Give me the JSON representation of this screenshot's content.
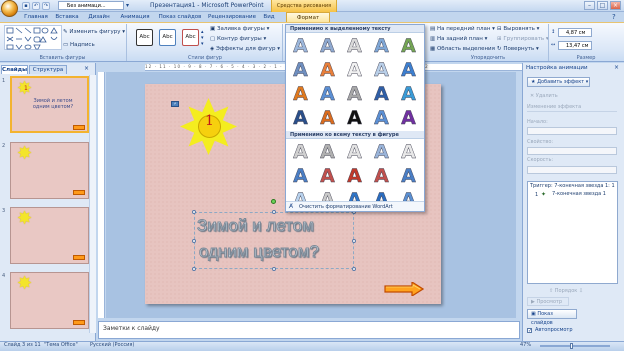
{
  "window": {
    "title": "Презентация1 - Microsoft PowerPoint",
    "context_tab": "Средства рисования",
    "qat_combo": "Без анимаци..."
  },
  "tabs": [
    "Главная",
    "Вставка",
    "Дизайн",
    "Анимация",
    "Показ слайдов",
    "Рецензирование",
    "Вид",
    "Формат"
  ],
  "ribbon": {
    "insert_shapes_group": "Вставить фигуры",
    "change_shape": "Изменить фигуру",
    "label_btn": "Надпись",
    "shape_styles_group": "Стили фигур",
    "style_sample": "Abc",
    "shape_fill": "Заливка фигуры",
    "shape_outline": "Контур фигуры",
    "shape_effects": "Эффекты для фигур",
    "wordart_group": "Стили WordArt",
    "arrange_group": "Упорядочить",
    "bring_front": "На передний план",
    "send_back": "На задний план",
    "selection_pane": "Область выделения",
    "align": "Выровнять",
    "group": "Группировать",
    "rotate": "Повернуть",
    "size_group": "Размер",
    "height": "4,87 см",
    "width": "13,47 см"
  },
  "left_panel": {
    "tab_slides": "Слайды",
    "tab_outline": "Структура",
    "slides": [
      {
        "num": "1",
        "star_num": "1",
        "text": "Зимой и летом одним цветом?"
      },
      {
        "num": "2"
      },
      {
        "num": "3"
      },
      {
        "num": "4"
      }
    ]
  },
  "ruler_text": "12 · 11 · 10 · 9 · 8 · 7 · 6 · 5 · 4 · 3 · 2 · 1 · 0 · 1 · 2 · 3 · 4 · 5 · 6 · 7 · 8 · 9 · 10 · 11 · 12",
  "slide": {
    "star_number": "1",
    "text_line1": "Зимой и летом",
    "text_line2": "одним цветом?"
  },
  "notes_placeholder": "Заметки к слайду",
  "gallery": {
    "section_selected": "Применимо к выделенному тексту",
    "section_all": "Применимо ко всему тексту в фигуре",
    "clear": "Очистить форматирование WordArt",
    "letter": "A",
    "colors_selected": [
      [
        "#9db8dc",
        "#8fa9cf",
        "#d9d9d9",
        "#7fa7d6",
        "#74a454"
      ],
      [
        "#6f8fbf",
        "#e87f3a",
        "#f1f1f1",
        "#b9cfe8",
        "#3d7fcf"
      ],
      [
        "#e07a1f",
        "#5b8fd3",
        "#a7a7a7",
        "#2f5fa7",
        "#3a9bd6"
      ],
      [
        "#2a4f8a",
        "#d96c1f",
        "#111111",
        "#5b8fd3",
        "#7030a0"
      ]
    ],
    "colors_all": [
      [
        "#d0d0d0",
        "#b0b0b0",
        "#e3e3e3",
        "#9ab4d9",
        "#e8e8e8"
      ],
      [
        "#4a7ec4",
        "#c0504d",
        "#c0392b",
        "#c0504d",
        "#4a7ec4"
      ],
      [
        "#b9d3ee",
        "#c9c9c9",
        "#2f75c7",
        "#2a6cbf",
        "#5a8fd1"
      ]
    ]
  },
  "right_panel": {
    "title": "Настройка анимации",
    "add_effect": "Добавить эффект",
    "remove": "Удалить",
    "change_effect": "Изменение эффекта",
    "start_label": "Начало:",
    "property_label": "Свойство:",
    "speed_label": "Скорость:",
    "trigger": "Триггер: 7-конечная звезда 1: 1",
    "item_num": "1",
    "item_label": "7-конечная звезда 1",
    "order_label": "Порядок",
    "preview": "Просмотр",
    "slideshow": "Показ слайдов",
    "autopreview": "Автопросмотр"
  },
  "status": {
    "slide_info": "Слайд 3 из 11",
    "theme": "\"Тема Office\"",
    "lang": "Русский (Россия)",
    "zoom": "47%"
  }
}
